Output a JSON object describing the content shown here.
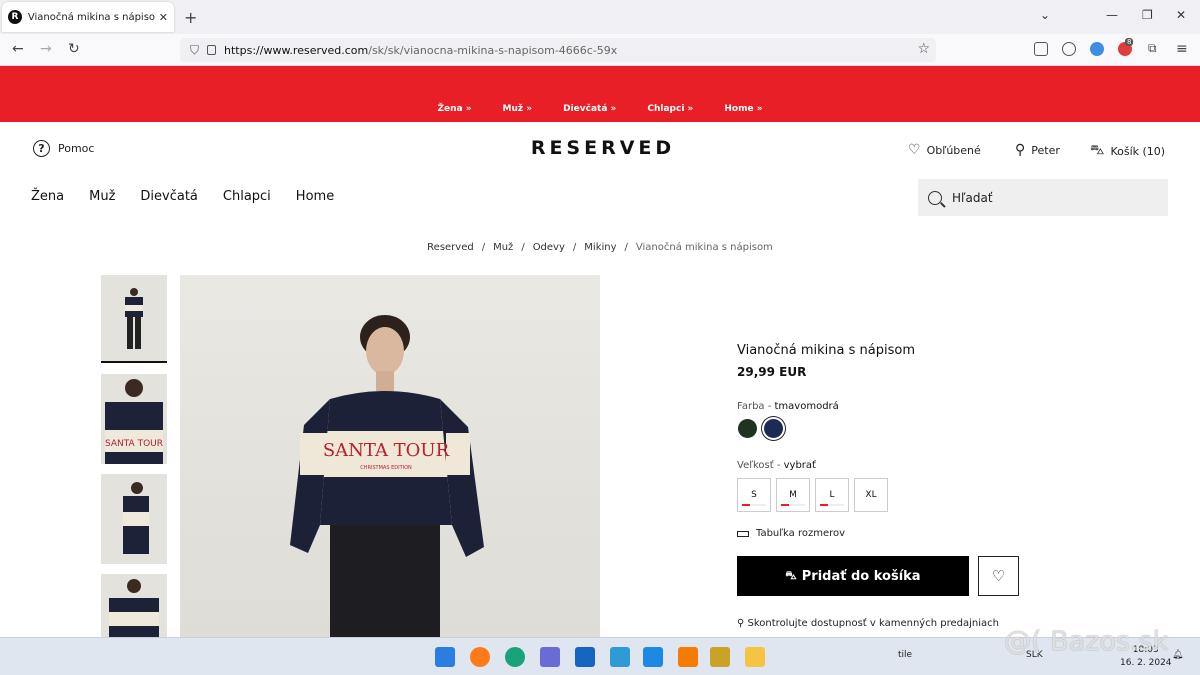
{
  "browser": {
    "tab_title": "Vianočná mikina s nápisom Farb",
    "tab_favicon": "R",
    "url_host": "https://www.reserved.com",
    "url_path": "/sk/sk/vianocna-mikina-s-napisom-4666c-59x",
    "extension_badge": "8"
  },
  "category_strip": [
    "Žena »",
    "Muž »",
    "Dievčatá »",
    "Chlapci »",
    "Home »"
  ],
  "header": {
    "help_label": "Pomoc",
    "logo": "RESERVED",
    "favorites_label": "Obľúbené",
    "account_label": "Peter",
    "cart_label": "Košík (10)"
  },
  "main_nav": [
    "Žena",
    "Muž",
    "Dievčatá",
    "Chlapci",
    "Home"
  ],
  "search": {
    "placeholder": "Hľadať"
  },
  "breadcrumb": [
    "Reserved",
    "Muž",
    "Odevy",
    "Mikiny",
    "Vianočná mikina s nápisom"
  ],
  "product": {
    "title": "Vianočná mikina s nápisom",
    "price": "29,99 EUR",
    "color_label": "Farba - ",
    "color_value": "tmavomodrá",
    "colors": [
      "#1f3320",
      "#1c2a55"
    ],
    "size_label": "Veľkosť - ",
    "size_value": "vybrať",
    "sizes": [
      {
        "label": "S",
        "availability": 0.35
      },
      {
        "label": "M",
        "availability": 0.35
      },
      {
        "label": "L",
        "availability": 0.35
      },
      {
        "label": "XL",
        "availability": 0
      }
    ],
    "size_chart_label": "Tabuľka rozmerov",
    "add_to_cart_label": "Pridať do košíka",
    "stores_label": "Skontrolujte dostupnosť v kamenných predajniach",
    "print_text": "SANTA TOUR",
    "print_subtext": "CHRISTMAS EDITION"
  },
  "taskbar": {
    "lang": "SLK",
    "time": "18:03",
    "date": "16. 2. 2024",
    "tray_text": "tile"
  },
  "watermark": "@( Bazos.sk",
  "colors": {
    "brand_red": "#e81f27",
    "button_black": "#000000"
  }
}
